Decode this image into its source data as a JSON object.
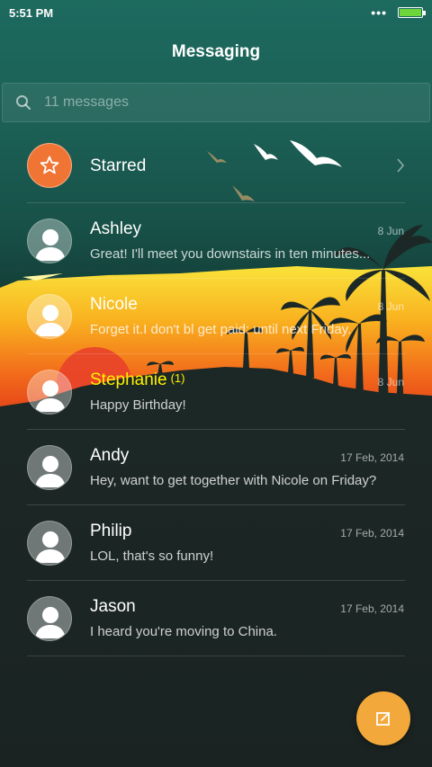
{
  "status_bar": {
    "time": "5:51 PM",
    "overflow_icon": "more-dots-icon",
    "battery_icon": "battery-icon",
    "battery_level": 1.0
  },
  "header": {
    "title": "Messaging"
  },
  "search": {
    "placeholder": "11 messages",
    "icon": "search-icon"
  },
  "starred": {
    "label": "Starred",
    "icon": "star-icon",
    "chevron_icon": "chevron-right-icon"
  },
  "conversations": [
    {
      "name": "Ashley",
      "preview": "Great! I'll meet you downstairs in ten minutes...",
      "date": "8 Jun",
      "unread": ""
    },
    {
      "name": "Nicole",
      "preview": "Forget it.I don't bl get paid: until next Friday.",
      "date": "8 Jun",
      "unread": ""
    },
    {
      "name": "Stephanie",
      "preview": "Happy Birthday!",
      "date": "8 Jun",
      "unread": "(1)"
    },
    {
      "name": "Andy",
      "preview": "Hey, want to get together with Nicole on Friday?",
      "date": "17 Feb, 2014",
      "unread": ""
    },
    {
      "name": "Philip",
      "preview": "LOL, that's so funny!",
      "date": "17 Feb, 2014",
      "unread": ""
    },
    {
      "name": "Jason",
      "preview": "I heard you're moving to China.",
      "date": "17 Feb, 2014",
      "unread": ""
    }
  ],
  "fab": {
    "icon": "compose-icon"
  },
  "colors": {
    "accent_orange": "#f07535",
    "fab_orange": "#f3a83b",
    "unread_yellow": "#fff200",
    "battery_green": "#6ed63a"
  }
}
